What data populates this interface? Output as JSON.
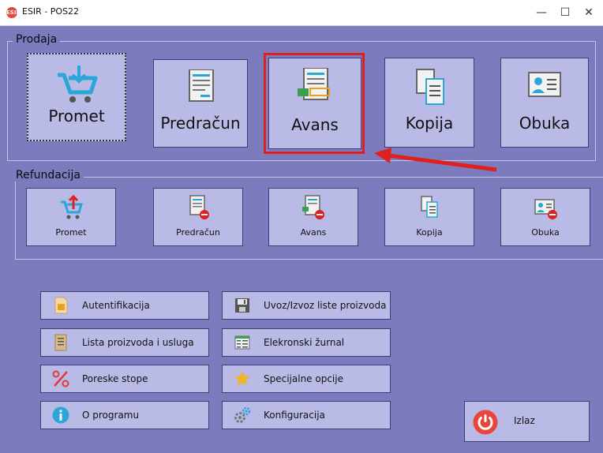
{
  "window": {
    "title": "ESIR - POS22",
    "app_icon_text": "ESIR",
    "controls": {
      "minimize": "—",
      "maximize": "☐",
      "close": "✕"
    }
  },
  "prodaja": {
    "title": "Prodaja",
    "buttons": [
      {
        "label": "Promet",
        "icon": "cart-down-icon"
      },
      {
        "label": "Predračun",
        "icon": "invoice-icon"
      },
      {
        "label": "Avans",
        "icon": "advance-icon"
      },
      {
        "label": "Kopija",
        "icon": "copy-icon"
      },
      {
        "label": "Obuka",
        "icon": "training-card-icon"
      }
    ],
    "highlighted": "Avans"
  },
  "refundacija": {
    "title": "Refundacija",
    "buttons": [
      {
        "label": "Promet",
        "icon": "cart-up-icon"
      },
      {
        "label": "Predračun",
        "icon": "invoice-minus-icon"
      },
      {
        "label": "Avans",
        "icon": "advance-minus-icon"
      },
      {
        "label": "Kopija",
        "icon": "copy-icon"
      },
      {
        "label": "Obuka",
        "icon": "training-card-minus-icon"
      }
    ]
  },
  "tools_left": [
    {
      "label": "Autentifikacija",
      "icon": "sim-card-icon"
    },
    {
      "label": "Lista proizvoda i usluga",
      "icon": "list-icon"
    },
    {
      "label": "Poreske stope",
      "icon": "percent-icon"
    },
    {
      "label": "O programu",
      "icon": "info-icon"
    }
  ],
  "tools_right": [
    {
      "label": "Uvoz/Izvoz liste proizvoda",
      "icon": "floppy-icon"
    },
    {
      "label": "Elekronski žurnal",
      "icon": "journal-icon"
    },
    {
      "label": "Specijalne opcije",
      "icon": "star-icon"
    },
    {
      "label": "Konfiguracija",
      "icon": "gears-icon"
    }
  ],
  "exit": {
    "label": "Izlaz",
    "icon": "power-icon"
  },
  "colors": {
    "background": "#7b7bbd",
    "button": "#babae6",
    "highlight": "#e02020",
    "arrow": "#e02020"
  }
}
